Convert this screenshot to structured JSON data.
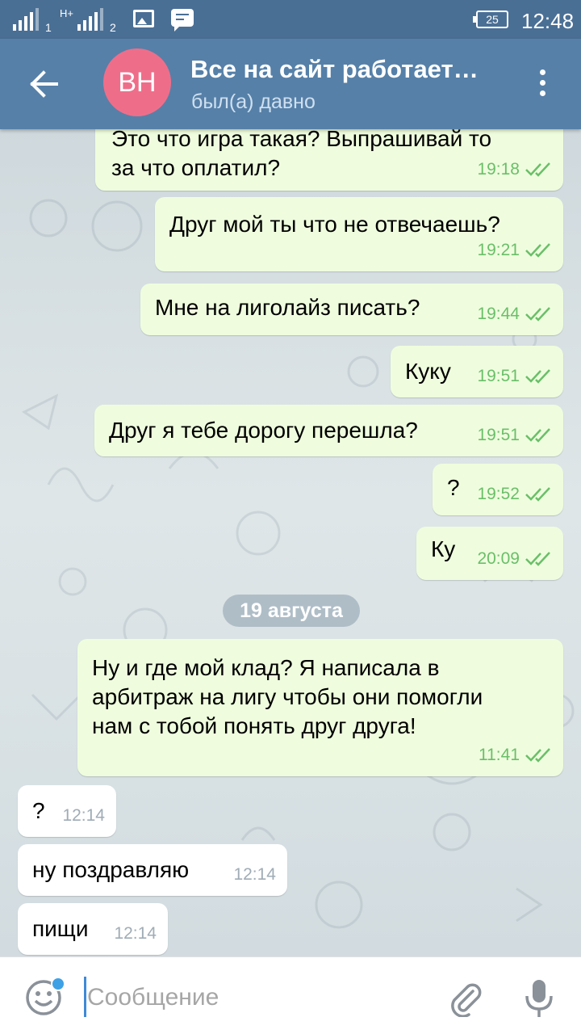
{
  "statusbar": {
    "sim1": "1",
    "sim2": "2",
    "network": "H+",
    "battery": "25",
    "time": "12:48"
  },
  "header": {
    "back_icon": "arrow-left-icon",
    "avatar_initials": "BH",
    "avatar_color": "#ee6e8a",
    "title": "Все на сайт работает…",
    "status": "был(а) давно",
    "menu_icon": "more-vertical-icon"
  },
  "messages": [
    {
      "dir": "out",
      "text": "Это что игра такая? Выпрашивай то\nза что оплатил?",
      "time": "19:18",
      "read": true
    },
    {
      "dir": "out",
      "text": "Друг мой ты что не отвечаешь?",
      "time": "19:21",
      "read": true
    },
    {
      "dir": "out",
      "text": "Мне на лиголайз писать?",
      "time": "19:44",
      "read": true
    },
    {
      "dir": "out",
      "text": "Куку",
      "time": "19:51",
      "read": true
    },
    {
      "dir": "out",
      "text": "Друг я тебе дорогу перешла?",
      "time": "19:51",
      "read": true
    },
    {
      "dir": "out",
      "text": "?",
      "time": "19:52",
      "read": true
    },
    {
      "dir": "out",
      "text": "Ку",
      "time": "20:09",
      "read": true
    },
    {
      "dir": "out",
      "text": "Ну и где мой клад? Я написала в\nарбитраж на лигу чтобы они помогли\nнам с тобой понять друг друга!",
      "time": "11:41",
      "read": true
    },
    {
      "dir": "in",
      "text": "?",
      "time": "12:14"
    },
    {
      "dir": "in",
      "text": "ну поздравляю",
      "time": "12:14"
    },
    {
      "dir": "in",
      "text": "пищи",
      "time": "12:14"
    }
  ],
  "date_separator": "19 августа",
  "input": {
    "placeholder": "Сообщение",
    "emoji_icon": "smile-icon",
    "attach_icon": "paperclip-icon",
    "mic_icon": "microphone-icon"
  },
  "colors": {
    "header": "#5680a8",
    "outgoing_bubble": "#effdde",
    "incoming_bubble": "#ffffff",
    "read_check": "#6abf69"
  }
}
